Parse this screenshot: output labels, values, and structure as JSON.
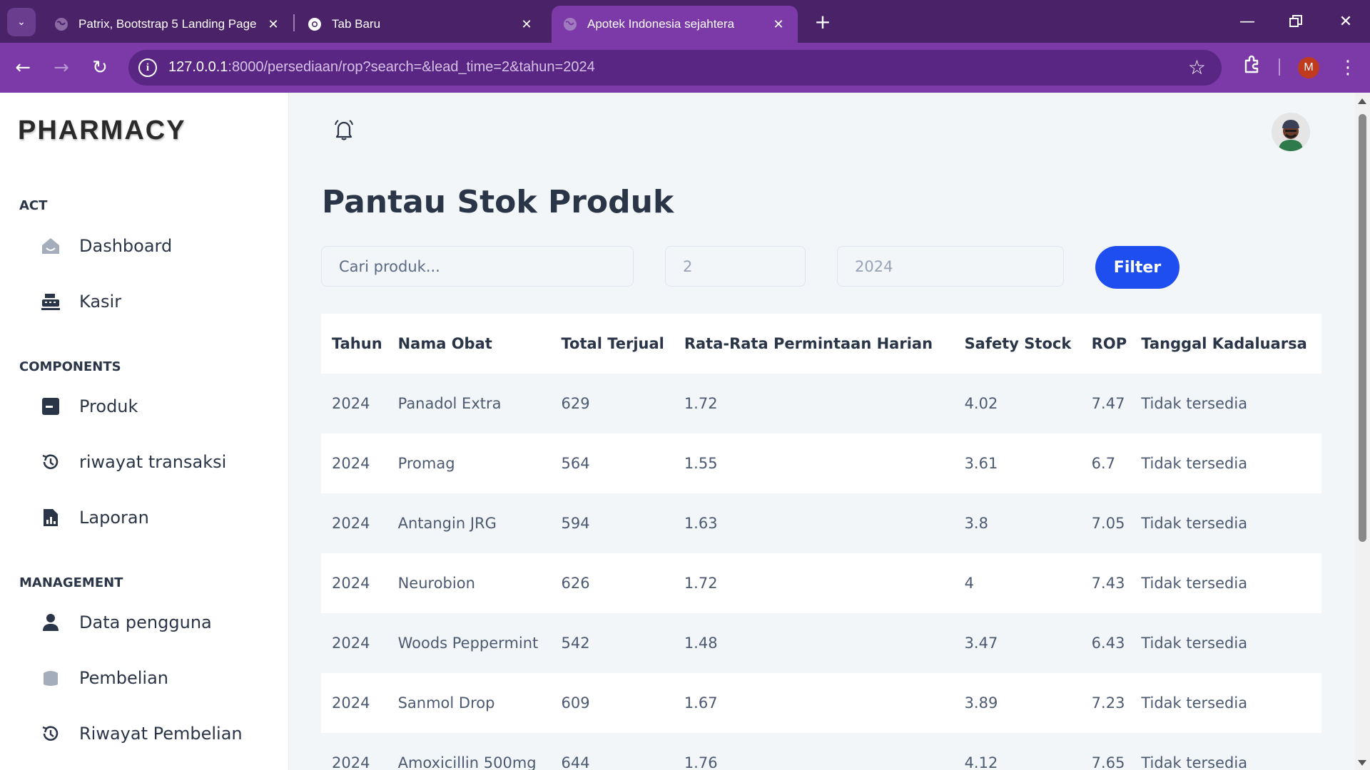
{
  "browser": {
    "tabs": [
      {
        "title": "Patrix, Bootstrap 5 Landing Page",
        "favicon": "globe-icon"
      },
      {
        "title": "Tab Baru",
        "favicon": "chrome-icon"
      },
      {
        "title": "Apotek Indonesia sejahtera",
        "favicon": "globe-icon"
      }
    ],
    "url_host": "127.0.0.1",
    "url_rest": ":8000/persediaan/rop?search=&lead_time=2&tahun=2024",
    "profile_initial": "M"
  },
  "sidebar": {
    "brand": "PHARMACY",
    "sections": [
      {
        "title": "ACT",
        "items": [
          {
            "label": "Dashboard",
            "icon": "dashboard-icon"
          },
          {
            "label": "Kasir",
            "icon": "cash-register-icon"
          }
        ]
      },
      {
        "title": "COMPONENTS",
        "items": [
          {
            "label": "Produk",
            "icon": "product-icon"
          },
          {
            "label": "riwayat transaksi",
            "icon": "history-icon"
          },
          {
            "label": "Laporan",
            "icon": "report-icon"
          }
        ]
      },
      {
        "title": "MANAGEMENT",
        "items": [
          {
            "label": "Data pengguna",
            "icon": "user-icon"
          },
          {
            "label": "Pembelian",
            "icon": "basket-icon"
          },
          {
            "label": "Riwayat Pembelian",
            "icon": "history-icon"
          }
        ]
      }
    ]
  },
  "main": {
    "title": "Pantau Stok Produk",
    "search_placeholder": "Cari produk...",
    "lead_time": "2",
    "tahun": "2024",
    "filter_label": "Filter",
    "table": {
      "headers": [
        "Tahun",
        "Nama Obat",
        "Total Terjual",
        "Rata-Rata Permintaan Harian",
        "Safety Stock",
        "ROP",
        "Tanggal Kadaluarsa"
      ],
      "rows": [
        [
          "2024",
          "Panadol Extra",
          "629",
          "1.72",
          "4.02",
          "7.47",
          "Tidak tersedia"
        ],
        [
          "2024",
          "Promag",
          "564",
          "1.55",
          "3.61",
          "6.7",
          "Tidak tersedia"
        ],
        [
          "2024",
          "Antangin JRG",
          "594",
          "1.63",
          "3.8",
          "7.05",
          "Tidak tersedia"
        ],
        [
          "2024",
          "Neurobion",
          "626",
          "1.72",
          "4",
          "7.43",
          "Tidak tersedia"
        ],
        [
          "2024",
          "Woods Peppermint",
          "542",
          "1.48",
          "3.47",
          "6.43",
          "Tidak tersedia"
        ],
        [
          "2024",
          "Sanmol Drop",
          "609",
          "1.67",
          "3.89",
          "7.23",
          "Tidak tersedia"
        ],
        [
          "2024",
          "Amoxicillin 500mg",
          "644",
          "1.76",
          "4.12",
          "7.65",
          "Tidak tersedia"
        ]
      ]
    }
  }
}
